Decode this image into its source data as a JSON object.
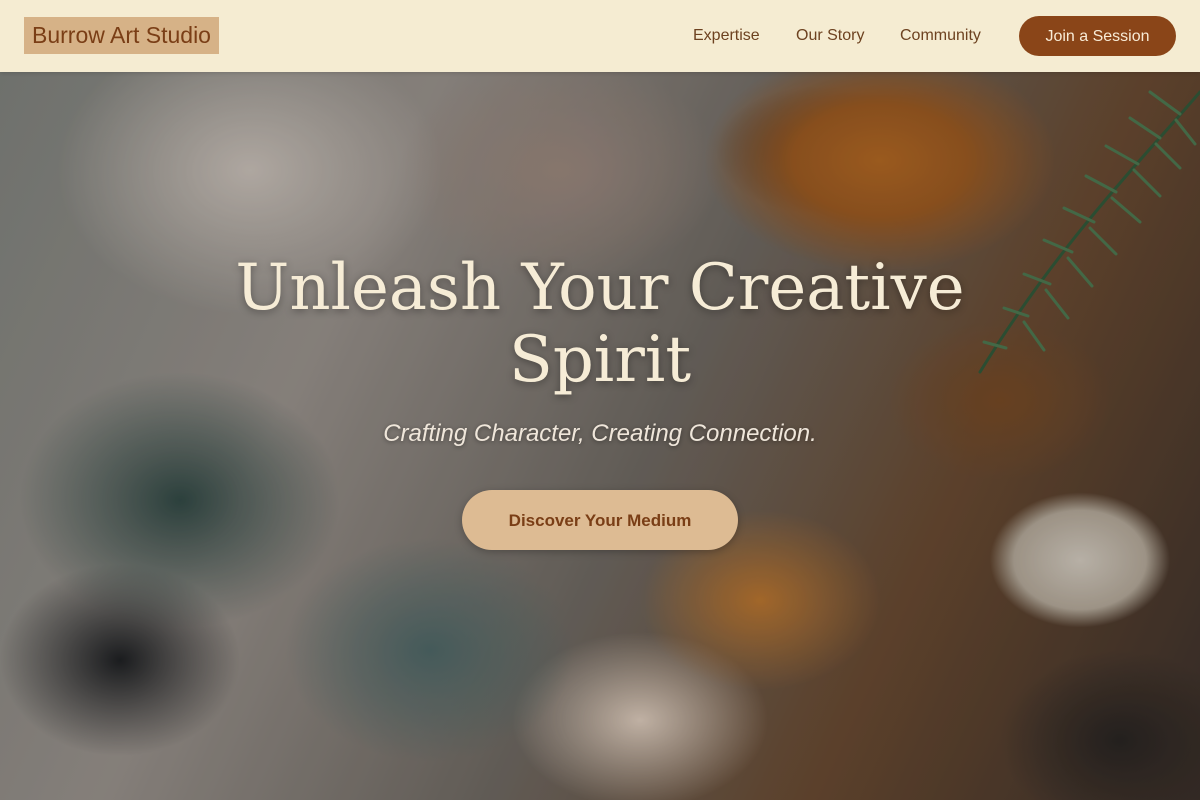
{
  "header": {
    "logo": "Burrow Art Studio",
    "nav": [
      {
        "label": "Expertise"
      },
      {
        "label": "Our Story"
      },
      {
        "label": "Community"
      }
    ],
    "cta_label": "Join a Session"
  },
  "hero": {
    "title": "Unleash Your Creative Spirit",
    "subtitle": "Crafting Character, Creating Connection.",
    "button_label": "Discover Your Medium"
  },
  "colors": {
    "header_bg": "#f5ecd2",
    "logo_bg": "#d6b287",
    "accent_brown": "#8a4518",
    "hero_button_bg": "#ddbb93",
    "hero_text": "#f6ecd6"
  }
}
